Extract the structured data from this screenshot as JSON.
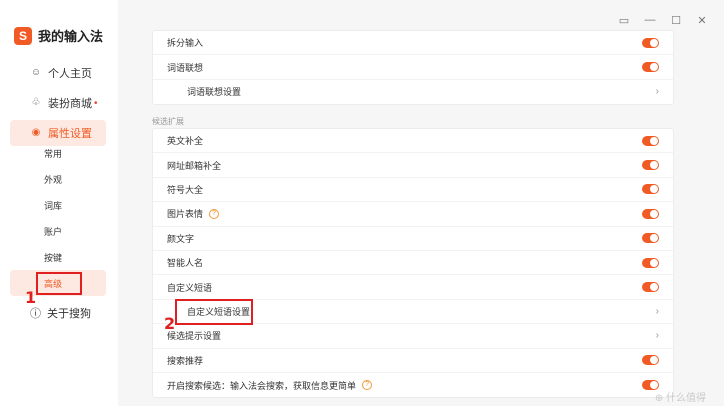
{
  "app": {
    "logo_letter": "S",
    "title": "我的输入法"
  },
  "nav": [
    {
      "label": "个人主页",
      "icon": "user-icon"
    },
    {
      "label": "装扮商城",
      "icon": "shirt-icon",
      "badge": "•"
    },
    {
      "label": "属性设置",
      "icon": "settings-icon",
      "active": true
    }
  ],
  "sub_nav": [
    "常用",
    "外观",
    "词库",
    "账户",
    "按键",
    "高级"
  ],
  "about": {
    "label": "关于搜狗",
    "icon": "info-icon"
  },
  "window_controls": [
    "feedback-icon",
    "minimize-icon",
    "maximize-icon",
    "close-icon"
  ],
  "window_glyphs": [
    "▭",
    "—",
    "☐",
    "✕"
  ],
  "section_top": [
    {
      "label": "拆分输入",
      "control": "toggle"
    },
    {
      "label": "词语联想",
      "control": "toggle"
    },
    {
      "label": "词语联想设置",
      "control": "chevron",
      "sub": true
    }
  ],
  "section_label": "候选扩展",
  "section_ext": [
    {
      "label": "英文补全",
      "control": "toggle"
    },
    {
      "label": "网址邮箱补全",
      "control": "toggle"
    },
    {
      "label": "符号大全",
      "control": "toggle"
    },
    {
      "label": "图片表情",
      "control": "toggle",
      "help": true
    },
    {
      "label": "颜文字",
      "control": "toggle"
    },
    {
      "label": "智能人名",
      "control": "toggle"
    },
    {
      "label": "自定义短语",
      "control": "toggle"
    },
    {
      "label": "自定义短语设置",
      "control": "chevron",
      "sub": true
    },
    {
      "label": "候选提示设置",
      "control": "chevron"
    },
    {
      "label": "搜索推荐",
      "control": "toggle"
    },
    {
      "label": "开启搜索候选：输入法会搜索，获取信息更简单",
      "control": "toggle",
      "help": true
    }
  ],
  "annotations": {
    "one": "1",
    "two": "2"
  },
  "colors": {
    "accent": "#f15a24",
    "annotation": "#e02020"
  },
  "watermark": "⊕ 什么值得"
}
